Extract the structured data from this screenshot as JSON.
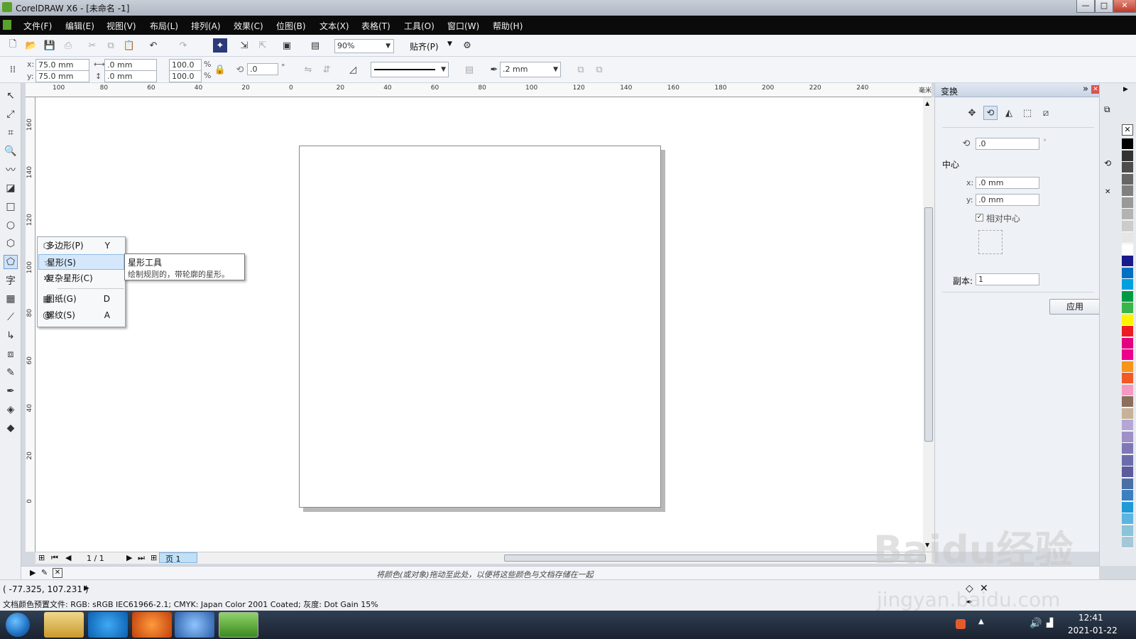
{
  "window": {
    "title": "CorelDRAW X6 - [未命名 -1]",
    "min": "—",
    "max": "□",
    "close": "✕"
  },
  "menu": [
    "文件(F)",
    "编辑(E)",
    "视图(V)",
    "布局(L)",
    "排列(A)",
    "效果(C)",
    "位图(B)",
    "文本(X)",
    "表格(T)",
    "工具(O)",
    "窗口(W)",
    "帮助(H)"
  ],
  "toolbar": {
    "zoom": "90%",
    "snap": "贴齐(P)"
  },
  "propbar": {
    "x": "75.0 mm",
    "y": "75.0 mm",
    "w": ".0 mm",
    "h": ".0 mm",
    "sx": "100.0",
    "sy": "100.0",
    "pct": "%",
    "angle": ".0",
    "deg": "°",
    "outline": ".2 mm"
  },
  "ruler": {
    "unit": "毫米",
    "h_labels": [
      "100",
      "80",
      "60",
      "40",
      "20",
      "0",
      "20",
      "40",
      "60",
      "80",
      "100",
      "120",
      "140",
      "160",
      "180",
      "200",
      "220",
      "240"
    ],
    "v_labels": [
      "160",
      "140",
      "120",
      "100",
      "80",
      "60",
      "40",
      "20",
      "0"
    ]
  },
  "flyout": {
    "items": [
      {
        "icon": "⬡",
        "label": "多边形(P)",
        "key": "Y"
      },
      {
        "icon": "☆",
        "label": "星形(S)",
        "key": ""
      },
      {
        "icon": "✲",
        "label": "复杂星形(C)",
        "key": ""
      },
      {
        "icon": "▦",
        "label": "图纸(G)",
        "key": "D"
      },
      {
        "icon": "@",
        "label": "螺纹(S)",
        "key": "A"
      }
    ]
  },
  "tooltip": {
    "title": "星形工具",
    "desc": "绘制规则的，带轮廓的星形。"
  },
  "pagenav": {
    "count": "1 / 1",
    "tab": "页 1"
  },
  "palette_hint": "将颜色(或对象)拖动至此处，以便将这些颜色与文档存储在一起",
  "docker": {
    "title": "变换",
    "angle": ".0",
    "center_label": "中心",
    "cx": ".0 mm",
    "cy": ".0 mm",
    "x_lbl": "x:",
    "y_lbl": "y:",
    "relative": "相对中心",
    "copies_label": "副本:",
    "copies": "1",
    "apply": "应用"
  },
  "status": {
    "coords": "( -77.325, 107.231 )",
    "color_profile": "文档颜色预置文件: RGB: sRGB IEC61966-2.1; CMYK: Japan Color 2001 Coated; 灰度: Dot Gain 15%"
  },
  "taskbar": {
    "time": "12:41",
    "date": "2021-01-22"
  },
  "watermark": {
    "main": "Baidu经验",
    "sub": "jingyan.baidu.com"
  },
  "palette_colors": [
    "#000000",
    "#333333",
    "#4d4d4d",
    "#666666",
    "#808080",
    "#999999",
    "#b3b3b3",
    "#cccccc",
    "#e6e6e6",
    "#ffffff",
    "#1a1a8c",
    "#0070c0",
    "#00a0e0",
    "#009a44",
    "#39b54a",
    "#fff200",
    "#ed1c24",
    "#e4007f",
    "#ec008c",
    "#f7941d",
    "#f15a24",
    "#f49ac1",
    "#8c6e5d",
    "#c7b299",
    "#b4a7d6",
    "#9e8fc7",
    "#7f77b8",
    "#6c6cad",
    "#5b5b9e",
    "#4a6fa5",
    "#3a7fc1",
    "#1f9ad6",
    "#5bb5e0",
    "#8ac4d8",
    "#a5c8d6"
  ]
}
